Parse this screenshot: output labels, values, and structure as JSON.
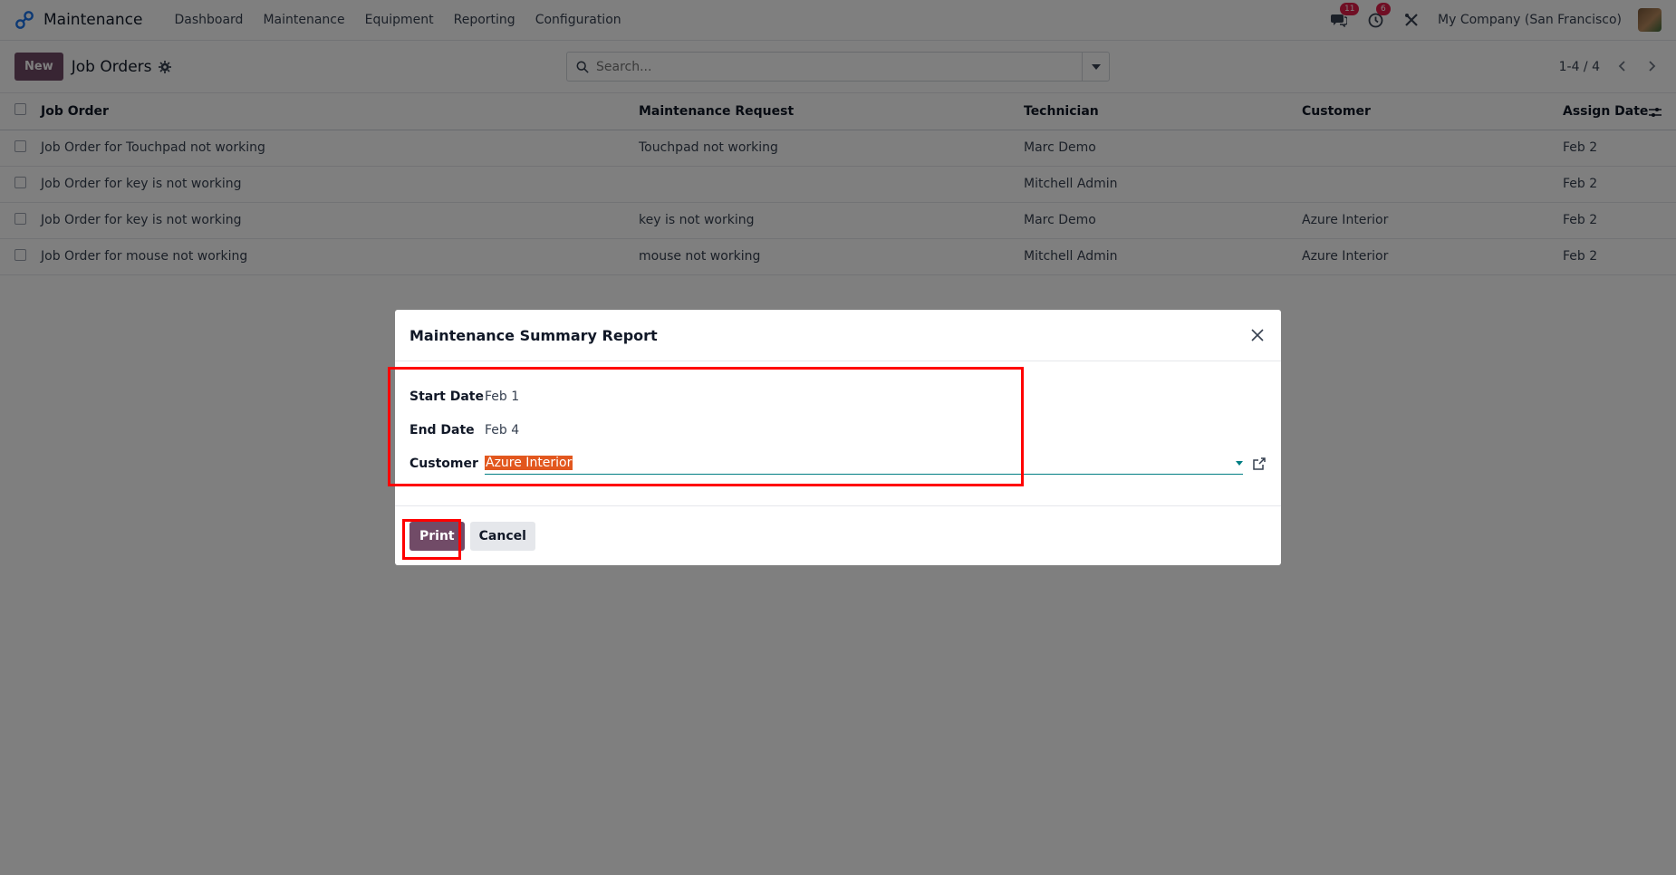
{
  "navbar": {
    "app_name": "Maintenance",
    "menu": [
      "Dashboard",
      "Maintenance",
      "Equipment",
      "Reporting",
      "Configuration"
    ],
    "messages_badge": "11",
    "activities_badge": "6",
    "company": "My Company (San Francisco)",
    "icons": [
      "app-logo-icon",
      "chat-icon",
      "clock-icon",
      "tools-icon",
      "user-avatar"
    ]
  },
  "control": {
    "new_label": "New",
    "title": "Job Orders",
    "search_placeholder": "Search...",
    "pager": "1-4 / 4"
  },
  "table": {
    "headers": [
      "Job Order",
      "Maintenance Request",
      "Technician",
      "Customer",
      "Assign Date"
    ],
    "rows": [
      [
        "Job Order for Touchpad not working",
        "Touchpad not working",
        "Marc Demo",
        "",
        "Feb 2"
      ],
      [
        "Job Order for key is not working",
        "",
        "Mitchell Admin",
        "",
        "Feb 2"
      ],
      [
        "Job Order for key is not working",
        "key is not working",
        "Marc Demo",
        "Azure Interior",
        "Feb 2"
      ],
      [
        "Job Order for mouse not working",
        "mouse not working",
        "Mitchell Admin",
        "Azure Interior",
        "Feb 2"
      ]
    ]
  },
  "modal": {
    "title": "Maintenance Summary Report",
    "start_date_label": "Start Date",
    "start_date_value": "Feb 1",
    "end_date_label": "End Date",
    "end_date_value": "Feb 4",
    "customer_label": "Customer",
    "customer_value": "Azure Interior",
    "print_label": "Print",
    "cancel_label": "Cancel"
  },
  "colors": {
    "brand": "#714b67",
    "accent": "#017e84",
    "highlight": "#ff0000",
    "selection": "#e2571e"
  }
}
